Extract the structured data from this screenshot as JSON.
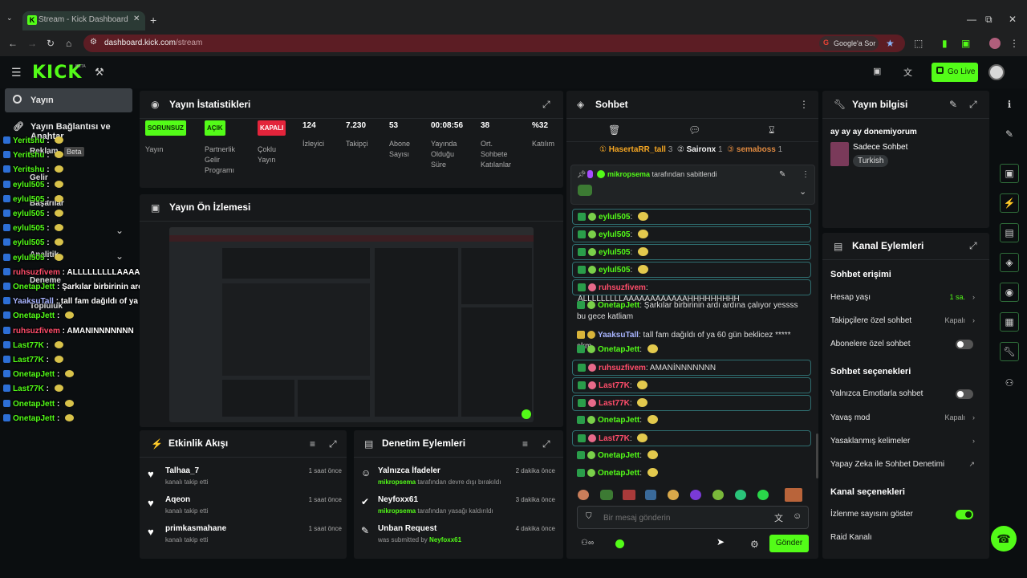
{
  "browser": {
    "tab_title": "Stream - Kick Dashboard",
    "url_host": "dashboard.kick.com",
    "url_path": "/stream",
    "google_label": "Google'a Sor"
  },
  "header": {
    "logo": "KICK",
    "beta": "BETA",
    "go_live": "Go Live"
  },
  "sidebar": {
    "items": [
      {
        "label": "Yayın",
        "icon": "play-icon"
      },
      {
        "label": "Yayın Bağlantısı ve Anahtar",
        "icon": "link-icon"
      },
      {
        "label": "Reklam",
        "badge": "Beta"
      },
      {
        "label": "Gelir"
      },
      {
        "label": "Başarılar"
      },
      {
        "label": "Topluluk"
      },
      {
        "label": "Analitik"
      },
      {
        "label": "Deneme"
      },
      {
        "label": "Topluluk"
      }
    ]
  },
  "overlay_chat": [
    {
      "user": "Yeritshu",
      "text": "",
      "cls": "u"
    },
    {
      "user": "Yeritshu",
      "text": "",
      "cls": "u"
    },
    {
      "user": "Yeritshu",
      "text": "",
      "cls": "u"
    },
    {
      "user": "eylul505",
      "text": "",
      "cls": "u"
    },
    {
      "user": "eylul505",
      "text": "",
      "cls": "u"
    },
    {
      "user": "eylul505",
      "text": "",
      "cls": "u"
    },
    {
      "user": "eylul505",
      "text": "",
      "cls": "u"
    },
    {
      "user": "eylul505",
      "text": "",
      "cls": "u"
    },
    {
      "user": "eylul505",
      "text": "",
      "cls": "u"
    },
    {
      "user": "ruhsuzfivem",
      "text": "ALLLLLLLLLAAAAAAAAAAAAHHHHHHHHH",
      "cls": "ur"
    },
    {
      "user": "OnetapJett",
      "text": "Şarkılar birbirinin ardı ardına çalıyor yessss bu gece katliam",
      "cls": "u"
    },
    {
      "user": "YaaksuTall",
      "text": "tall fam dağıldı of ya 60 gün beklicez ***** skm",
      "cls": "up"
    },
    {
      "user": "OnetapJett",
      "text": "",
      "cls": "u"
    },
    {
      "user": "ruhsuzfivem",
      "text": "AMANINNNNNNN",
      "cls": "ur"
    },
    {
      "user": "Last77K",
      "text": "",
      "cls": "u"
    },
    {
      "user": "Last77K",
      "text": "",
      "cls": "u"
    },
    {
      "user": "OnetapJett",
      "text": "",
      "cls": "u"
    },
    {
      "user": "Last77K",
      "text": "",
      "cls": "u"
    },
    {
      "user": "OnetapJett",
      "text": "",
      "cls": "u"
    },
    {
      "user": "OnetapJett",
      "text": "",
      "cls": "u"
    }
  ],
  "stats": {
    "title": "Yayın İstatistikleri",
    "badges": [
      {
        "badge": "SORUNSUZ",
        "label": "Yayın"
      },
      {
        "badge": "AÇIK",
        "label": "Partnerlik Gelir Programı"
      },
      {
        "badge": "KAPALI",
        "label": "Çoklu Yayın"
      }
    ],
    "values": [
      {
        "value": "124",
        "label": "İzleyici"
      },
      {
        "value": "7.230",
        "label": "Takipçi"
      },
      {
        "value": "53",
        "label": "Abone Sayısı"
      },
      {
        "value": "00:08:56",
        "label": "Yayında Olduğu Süre"
      },
      {
        "value": "38",
        "label": "Ort. Sohbete Katılanlar"
      },
      {
        "value": "%32",
        "label": "Katılım"
      }
    ]
  },
  "preview": {
    "title": "Yayın Ön İzlemesi"
  },
  "activity": {
    "title": "Etkinlik Akışı",
    "items": [
      {
        "name": "Talhaa_7",
        "desc": "kanalı takip etti",
        "time": "1 saat önce"
      },
      {
        "name": "Aqeon",
        "desc": "kanalı takip etti",
        "time": "1 saat önce"
      },
      {
        "name": "primkasmahane",
        "desc": "kanalı takip etti",
        "time": "1 saat önce"
      }
    ]
  },
  "moderation": {
    "title": "Denetim Eylemleri",
    "items": [
      {
        "name": "Yalnızca İfadeler",
        "who": "mikropsema",
        "desc": "tarafından devre dışı bırakıldı",
        "time": "2 dakika önce"
      },
      {
        "name": "Neyfoxx61",
        "who": "mikropsema",
        "desc": "tarafından yasağı kaldırıldı",
        "time": "3 dakika önce"
      },
      {
        "name": "Unban Request",
        "who": "Neyfoxx61",
        "desc": "was submitted by",
        "time": "4 dakika önce"
      }
    ]
  },
  "chat": {
    "title": "Sohbet",
    "top_gifters": [
      {
        "name": "HasertaRR_tall",
        "count": "3"
      },
      {
        "name": "Saironx",
        "count": "1"
      },
      {
        "name": "semaboss",
        "count": "1"
      }
    ],
    "pinned_by": "mikropsema",
    "pinned_text": "tarafından sabitlendi",
    "messages": [
      {
        "user": "eylul505",
        "text": "",
        "cls": "g",
        "boxed": true
      },
      {
        "user": "eylul505",
        "text": "",
        "cls": "g",
        "boxed": true
      },
      {
        "user": "eylul505",
        "text": "",
        "cls": "g",
        "boxed": true
      },
      {
        "user": "eylul505",
        "text": "",
        "cls": "g",
        "boxed": true
      },
      {
        "user": "ruhsuzfivem",
        "text": "ALLLLLLLLLAAAAAAAAAAAAHHHHHHHHH",
        "cls": "r",
        "boxed": true
      },
      {
        "user": "OnetapJett",
        "text": "Şarkılar birbirinin ardı ardına çalıyor yessss bu gece katliam",
        "cls": "g",
        "boxed": false
      },
      {
        "user": "YaaksuTall",
        "text": "tall fam dağıldı of ya 60 gün beklicez ***** skm",
        "cls": "p",
        "boxed": false
      },
      {
        "user": "OnetapJett",
        "text": "",
        "cls": "g",
        "boxed": false
      },
      {
        "user": "ruhsuzfivem",
        "text": "AMANİNNNNNNN",
        "cls": "r",
        "boxed": true
      },
      {
        "user": "Last77K",
        "text": "",
        "cls": "r",
        "boxed": true
      },
      {
        "user": "Last77K",
        "text": "",
        "cls": "r",
        "boxed": true
      },
      {
        "user": "OnetapJett",
        "text": "",
        "cls": "g",
        "boxed": false
      },
      {
        "user": "Last77K",
        "text": "",
        "cls": "r",
        "boxed": true
      },
      {
        "user": "OnetapJett",
        "text": "",
        "cls": "g",
        "boxed": false
      },
      {
        "user": "OnetapJett",
        "text": "",
        "cls": "g",
        "boxed": false
      }
    ],
    "placeholder": "Bir mesaj gönderin",
    "send": "Gönder"
  },
  "stream_info": {
    "title": "Yayın bilgisi",
    "stream_title": "ay ay ay donemiyorum",
    "category": "Sadece Sohbet",
    "tag": "Turkish"
  },
  "channel_actions": {
    "title": "Kanal Eylemleri",
    "chat_access": "Sohbet erişimi",
    "account_age": {
      "label": "Hesap yaşı",
      "value": "1 sa."
    },
    "followers_only": {
      "label": "Takipçilere özel sohbet",
      "value": "Kapalı"
    },
    "subs_only": {
      "label": "Abonelere özel sohbet"
    },
    "chat_options": "Sohbet seçenekleri",
    "emote_only": {
      "label": "Yalnızca Emotlarla sohbet"
    },
    "slow_mode": {
      "label": "Yavaş mod",
      "value": "Kapalı"
    },
    "banned_words": {
      "label": "Yasaklanmış kelimeler"
    },
    "ai_moderation": {
      "label": "Yapay Zeka ile Sohbet Denetimi"
    },
    "channel_options": "Kanal seçenekleri",
    "show_viewers": {
      "label": "İzlenme sayısını göster"
    },
    "raid": {
      "label": "Raid Kanalı"
    }
  },
  "colors": {
    "brand": "#53fc18",
    "bg": "#0b0e10",
    "panel": "#17191b"
  }
}
